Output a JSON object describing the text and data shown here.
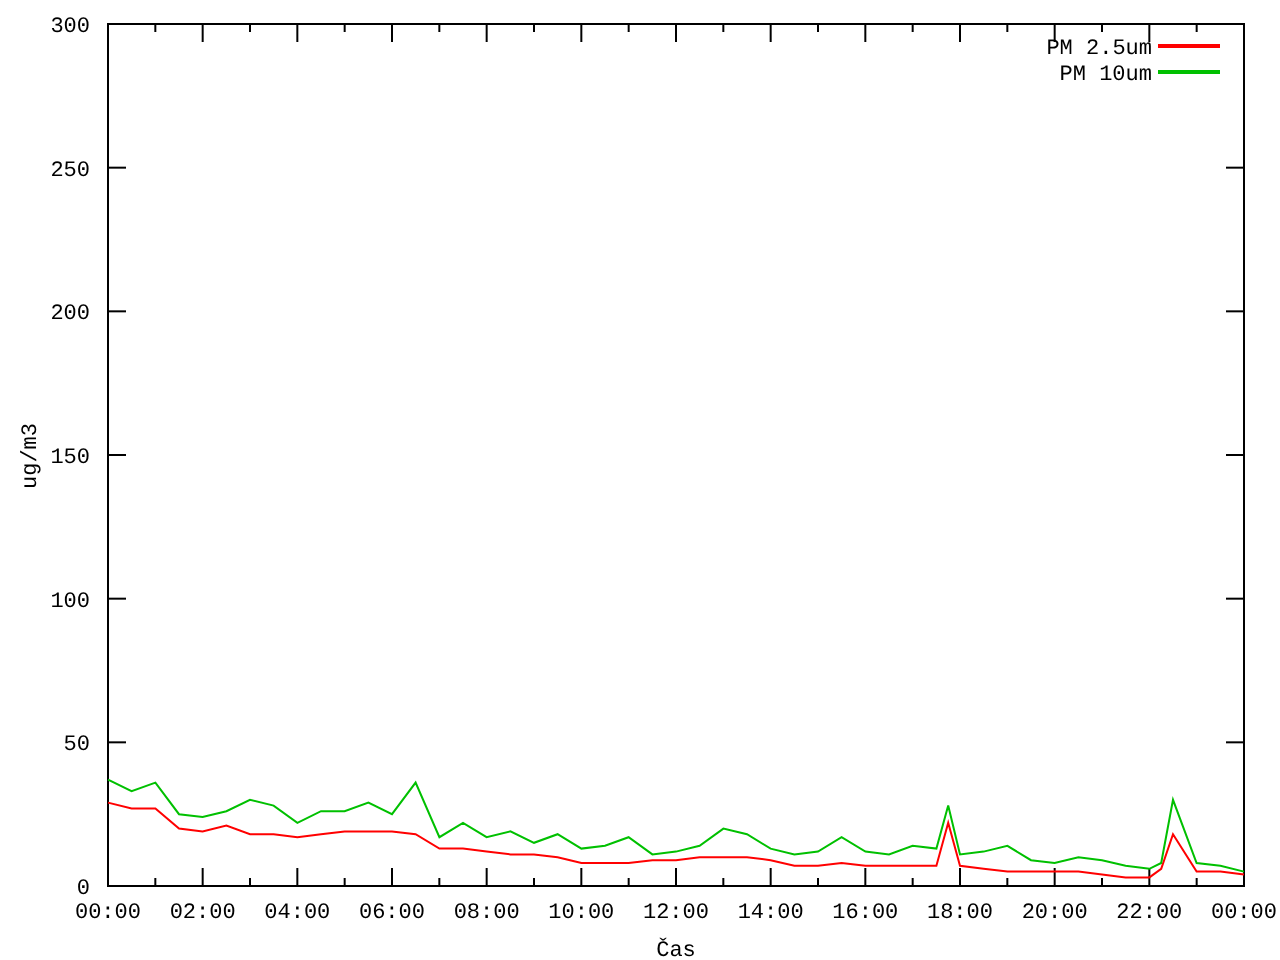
{
  "chart_data": {
    "type": "line",
    "xlabel": "Čas",
    "ylabel": "ug/m3",
    "x": [
      0,
      0.5,
      1,
      1.5,
      2,
      2.5,
      3,
      3.5,
      4,
      4.5,
      5,
      5.5,
      6,
      6.5,
      7,
      7.5,
      8,
      8.5,
      9,
      9.5,
      10,
      10.5,
      11,
      11.5,
      12,
      12.5,
      13,
      13.5,
      14,
      14.5,
      15,
      15.5,
      16,
      16.5,
      17,
      17.5,
      17.75,
      18,
      18.5,
      19,
      19.5,
      20,
      20.5,
      21,
      21.5,
      22,
      22.25,
      22.5,
      23,
      23.5,
      24
    ],
    "series": [
      {
        "name": "PM 2.5um",
        "color": "#ff0000",
        "values": [
          29,
          27,
          27,
          20,
          19,
          21,
          18,
          18,
          17,
          18,
          19,
          19,
          19,
          18,
          13,
          13,
          12,
          11,
          11,
          10,
          8,
          8,
          8,
          9,
          9,
          10,
          10,
          10,
          9,
          7,
          7,
          8,
          7,
          7,
          7,
          7,
          22,
          7,
          6,
          5,
          5,
          5,
          5,
          4,
          3,
          3,
          6,
          18,
          5,
          5,
          4
        ]
      },
      {
        "name": "PM 10um",
        "color": "#00c000",
        "values": [
          37,
          33,
          36,
          25,
          24,
          26,
          30,
          28,
          22,
          26,
          26,
          29,
          25,
          36,
          17,
          22,
          17,
          19,
          15,
          18,
          13,
          14,
          17,
          11,
          12,
          14,
          20,
          18,
          13,
          11,
          12,
          17,
          12,
          11,
          14,
          13,
          28,
          11,
          12,
          14,
          9,
          8,
          10,
          9,
          7,
          6,
          8,
          30,
          8,
          7,
          5
        ]
      }
    ],
    "xlim": [
      0,
      24
    ],
    "ylim": [
      0,
      300
    ],
    "xticks": [
      {
        "value": 0,
        "label": "00:00"
      },
      {
        "value": 2,
        "label": "02:00"
      },
      {
        "value": 4,
        "label": "04:00"
      },
      {
        "value": 6,
        "label": "06:00"
      },
      {
        "value": 8,
        "label": "08:00"
      },
      {
        "value": 10,
        "label": "10:00"
      },
      {
        "value": 12,
        "label": "12:00"
      },
      {
        "value": 14,
        "label": "14:00"
      },
      {
        "value": 16,
        "label": "16:00"
      },
      {
        "value": 18,
        "label": "18:00"
      },
      {
        "value": 20,
        "label": "20:00"
      },
      {
        "value": 22,
        "label": "22:00"
      },
      {
        "value": 24,
        "label": "00:00"
      }
    ],
    "yticks": [
      0,
      50,
      100,
      150,
      200,
      250,
      300
    ],
    "legend": true
  }
}
